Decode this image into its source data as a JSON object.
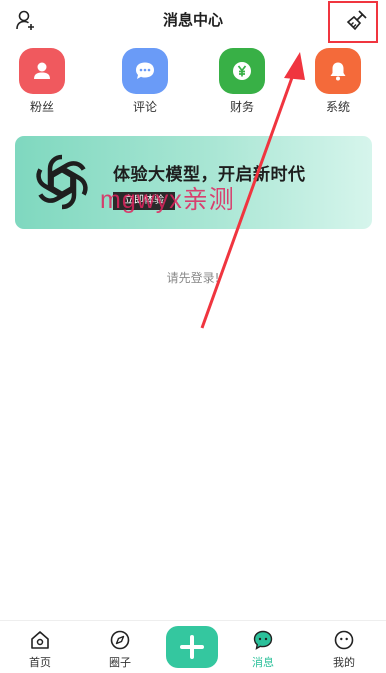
{
  "header": {
    "title": "消息中心",
    "left_icon": "add-user-icon",
    "right_icon": "broom-clear-icon"
  },
  "quick_actions": [
    {
      "label": "粉丝",
      "icon": "person-icon",
      "color": "#f0595e"
    },
    {
      "label": "评论",
      "icon": "chat-bubble-icon",
      "color": "#6a9bf7"
    },
    {
      "label": "财务",
      "icon": "yen-icon",
      "color": "#38b046"
    },
    {
      "label": "系统",
      "icon": "bell-icon",
      "color": "#f46a3a"
    }
  ],
  "banner": {
    "headline": "体验大模型，开启新时代",
    "cta_label": "立即体验",
    "logo_icon": "openai-logo-icon",
    "watermark": "mgwyx亲测"
  },
  "content": {
    "login_hint": "请先登录!"
  },
  "tabbar": {
    "items": [
      {
        "label": "首页",
        "icon": "home-icon",
        "active": false
      },
      {
        "label": "圈子",
        "icon": "compass-icon",
        "active": false
      },
      {
        "label": "",
        "icon": "plus-icon",
        "active": false
      },
      {
        "label": "消息",
        "icon": "message-icon",
        "active": true
      },
      {
        "label": "我的",
        "icon": "face-icon",
        "active": false
      }
    ]
  },
  "colors": {
    "accent": "#2bc09a",
    "annotation": "#f0353f"
  }
}
